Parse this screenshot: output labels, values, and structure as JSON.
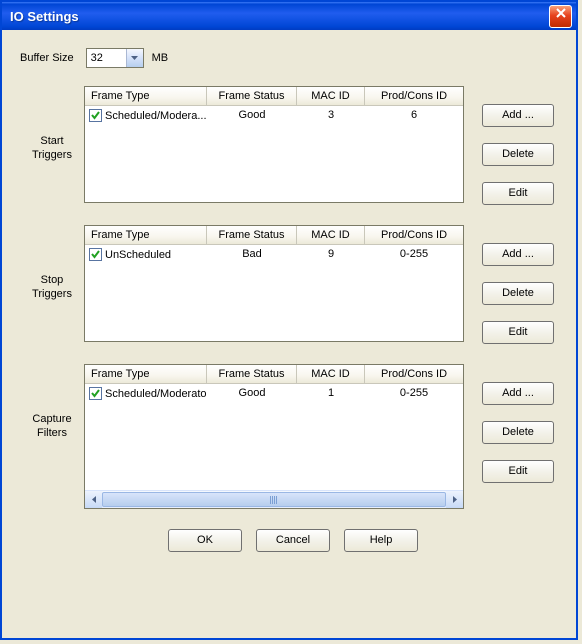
{
  "window": {
    "title": "IO Settings"
  },
  "buffer": {
    "label": "Buffer Size",
    "value": "32",
    "unit": "MB"
  },
  "columns": {
    "frame_type": "Frame Type",
    "frame_status": "Frame Status",
    "mac_id": "MAC ID",
    "prod_cons_id": "Prod/Cons ID"
  },
  "sections": [
    {
      "label1": "Start",
      "label2": "Triggers",
      "rows": [
        {
          "checked": true,
          "frame_type": "Scheduled/Modera...",
          "frame_status": "Good",
          "mac_id": "3",
          "prod_cons_id": "6"
        }
      ]
    },
    {
      "label1": "Stop",
      "label2": "Triggers",
      "rows": [
        {
          "checked": true,
          "frame_type": "UnScheduled",
          "frame_status": "Bad",
          "mac_id": "9",
          "prod_cons_id": "0-255"
        }
      ]
    },
    {
      "label1": "Capture",
      "label2": "Filters",
      "rows": [
        {
          "checked": true,
          "frame_type": "Scheduled/Moderator",
          "frame_status": "Good",
          "mac_id": "1",
          "prod_cons_id": "0-255"
        }
      ]
    }
  ],
  "buttons": {
    "add": "Add ...",
    "delete": "Delete",
    "edit": "Edit"
  },
  "bottom": {
    "ok": "OK",
    "cancel": "Cancel",
    "help": "Help"
  }
}
